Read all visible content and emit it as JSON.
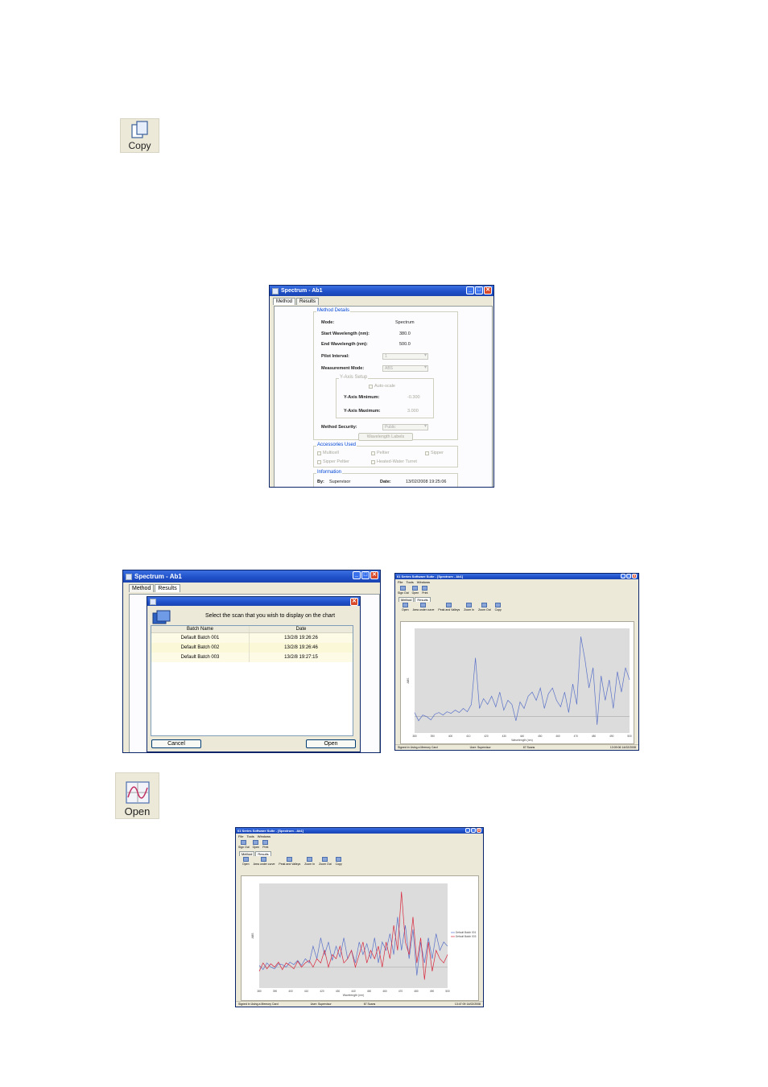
{
  "copy_button": {
    "label": "Copy",
    "icon": "copy-icon"
  },
  "open_button": {
    "label": "Open",
    "icon": "open-plot-icon"
  },
  "method_window": {
    "title": "Spectrum - Ab1",
    "tabs": [
      "Method",
      "Results"
    ],
    "method_details": {
      "heading": "Method Details",
      "mode_label": "Mode:",
      "mode_value": "Spectrum",
      "start_label": "Start Wavelength (nm):",
      "start_value": "380.0",
      "end_label": "End Wavelength (nm):",
      "end_value": "500.0",
      "interval_label": "Pilot Interval:",
      "interval_value": "1",
      "measurement_label": "Measurement Mode:",
      "measurement_value": "ABS",
      "yaxis_heading": "Y-Axis Setup",
      "autoscale_label": "Auto-scale",
      "ymin_label": "Y-Axis Minimum:",
      "ymin_value": "-0.300",
      "ymax_label": "Y-Axis Maximum:",
      "ymax_value": "3.000",
      "security_label": "Method Security:",
      "security_value": "Public",
      "wavelength_labels_button": "Wavelength Labels"
    },
    "accessories": {
      "heading": "Accessories Used",
      "items": [
        "Multicell",
        "Peltier",
        "Sipper",
        "Sipper Peltier",
        "Heated-Water Turret"
      ]
    },
    "information": {
      "heading": "Information",
      "by_label": "By:",
      "by_value": "Supervisor",
      "date_label": "Date:",
      "date_value": "13/02/2008 19:25:06"
    }
  },
  "results_window": {
    "title": "Spectrum - Ab1",
    "tabs": [
      "Method",
      "Results"
    ],
    "dialog": {
      "prompt": "Select the scan that you wish to display on the chart",
      "col_batch": "Batch Name",
      "col_date": "Date",
      "rows": [
        {
          "batch": "Default Batch 001",
          "date": "13/2/8 19:26:26"
        },
        {
          "batch": "Default Batch 002",
          "date": "13/2/8 19:26:46"
        },
        {
          "batch": "Default Batch 003",
          "date": "13/2/8 19:27:15"
        }
      ],
      "cancel_label": "Cancel",
      "open_label": "Open"
    }
  },
  "app1": {
    "title": "61 Series Software Suite - [Spectrum - Ab1]",
    "menu": [
      "File",
      "Tools",
      "Windows"
    ],
    "main_tools": [
      "Sign Out",
      "Open",
      "Print"
    ],
    "tabs": [
      "Method",
      "Results"
    ],
    "result_tools": [
      "Open",
      "Area under curve",
      "Peak and Valleys",
      "Zoom In",
      "Zoom Out",
      "Copy"
    ],
    "status": [
      "Signed in Using a Memory Card",
      "User: Supervisor",
      "67 Scans",
      "13:09:06 14/02/2008"
    ]
  },
  "app2": {
    "title": "61 Series Software Suite - [Spectrum - Ab1]",
    "menu": [
      "File",
      "Tools",
      "Windows"
    ],
    "main_tools": [
      "Sign Out",
      "Open",
      "Print"
    ],
    "tabs": [
      "Method",
      "Results"
    ],
    "result_tools": [
      "Open",
      "Area under curve",
      "Peak and Valleys",
      "Zoom In",
      "Zoom Out",
      "Copy"
    ],
    "legend": [
      "Default Batch 001",
      "Default Batch 003"
    ],
    "status": [
      "Signed in Using a Memory Card",
      "User: Supervisor",
      "67 Scans",
      "13:47:09 14/02/2008"
    ]
  },
  "colors": {
    "series_blue": "#5a72c8",
    "series_red": "#d8283c",
    "plot_bg": "#dcdcdc",
    "title_blue": "#1f4fc8"
  },
  "chart_data": [
    {
      "type": "line",
      "xlabel": "Wavelength (nm)",
      "ylabel": "ABS",
      "xlim": [
        380,
        500
      ],
      "x_ticks": [
        "380",
        "390",
        "400",
        "410",
        "420",
        "430",
        "440",
        "450",
        "460",
        "470",
        "480",
        "490",
        "500"
      ],
      "series": [
        {
          "values": [
            0.05,
            -0.05,
            0.02,
            0.0,
            -0.04,
            0.03,
            0.05,
            0.02,
            0.06,
            0.04,
            0.08,
            0.05,
            0.1,
            0.06,
            0.15,
            0.72,
            0.1,
            0.22,
            0.15,
            0.25,
            0.12,
            0.3,
            0.08,
            0.2,
            0.15,
            -0.05,
            0.18,
            0.1,
            0.25,
            0.3,
            0.2,
            0.35,
            0.1,
            0.28,
            0.35,
            0.2,
            0.12,
            0.3,
            0.05,
            0.4,
            0.15,
            0.98,
            0.7,
            0.35,
            0.6,
            -0.1,
            0.5,
            0.2,
            0.45,
            0.1,
            0.55,
            0.3,
            0.6,
            0.45
          ]
        }
      ]
    },
    {
      "type": "line",
      "xlabel": "Wavelength (nm)",
      "ylabel": "ABS",
      "xlim": [
        380,
        500
      ],
      "x_ticks": [
        "380",
        "390",
        "400",
        "410",
        "420",
        "430",
        "440",
        "450",
        "460",
        "470",
        "480",
        "490",
        "500"
      ],
      "series": [
        {
          "name": "Default Batch 001",
          "values": [
            0.02,
            -0.03,
            0.05,
            0.0,
            -0.02,
            0.04,
            0.03,
            0.0,
            0.06,
            0.03,
            0.08,
            0.02,
            0.1,
            0.05,
            0.25,
            0.1,
            0.35,
            0.15,
            0.3,
            0.08,
            0.25,
            0.12,
            0.35,
            0.1,
            0.2,
            0.05,
            0.3,
            0.15,
            0.28,
            0.1,
            0.35,
            0.05,
            0.3,
            0.2,
            0.4,
            0.15,
            0.6,
            0.2,
            0.5,
            0.1,
            0.45,
            -0.1,
            0.3,
            0.05,
            0.35,
            0.1,
            0.4,
            0.2,
            0.3,
            0.25
          ]
        },
        {
          "name": "Default Batch 003",
          "values": [
            -0.05,
            0.05,
            -0.02,
            0.04,
            0.0,
            0.06,
            -0.03,
            0.05,
            0.02,
            -0.02,
            0.07,
            0.0,
            0.05,
            0.08,
            0.0,
            0.1,
            0.05,
            0.2,
            0.0,
            0.15,
            0.1,
            0.25,
            0.05,
            0.1,
            0.2,
            0.0,
            0.15,
            0.3,
            0.05,
            0.2,
            0.1,
            0.25,
            0.0,
            0.3,
            0.1,
            0.5,
            0.2,
            0.9,
            0.3,
            0.15,
            0.6,
            0.05,
            0.35,
            -0.15,
            0.3,
            -0.05,
            0.2,
            0.1,
            0.05,
            0.15
          ]
        }
      ]
    }
  ]
}
